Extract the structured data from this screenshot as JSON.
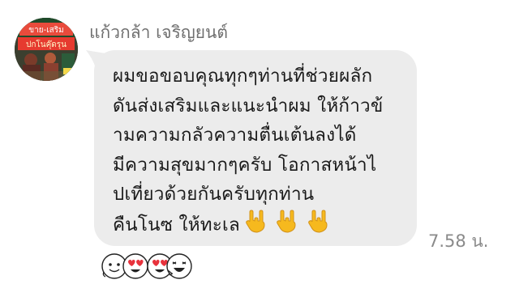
{
  "chat": {
    "sender_name": "แก้วกล้า เจริญยนต์",
    "avatar_sign_top": "ขาย-เสริม",
    "avatar_sign_bottom": "ปกโนคุ๊ดรุน",
    "message_lines": [
      "ผมขอขอบคุณทุกๆท่านที่ช่วยผลัก",
      "ดันส่งเสริมและแนะนำผม ให้ก้าวข้",
      "ามความกลัวความตื่นเต้นลงได้",
      "มีความสุขมากๆครับ โอกาสหน้าไ",
      "ปเที่ยวด้วยกันครับทุกท่าน",
      "คืนโนซ ให้ทะเล"
    ],
    "message_emoji_icons": [
      "rock-hand-icon",
      "rock-hand-icon",
      "rock-hand-icon"
    ],
    "timestamp": "7.58 น.",
    "reaction_stickers": [
      "sticker-face-plain",
      "sticker-face-heart-eyes",
      "sticker-face-heart-eyes",
      "sticker-face-laugh"
    ]
  },
  "colors": {
    "bubble_bg": "#ececec",
    "sender_text": "#6f6f6f",
    "message_text": "#1a1a1a",
    "time_text": "#8a8a8a",
    "emoji_yellow": "#f6b91e",
    "heart_red": "#e8323c"
  }
}
